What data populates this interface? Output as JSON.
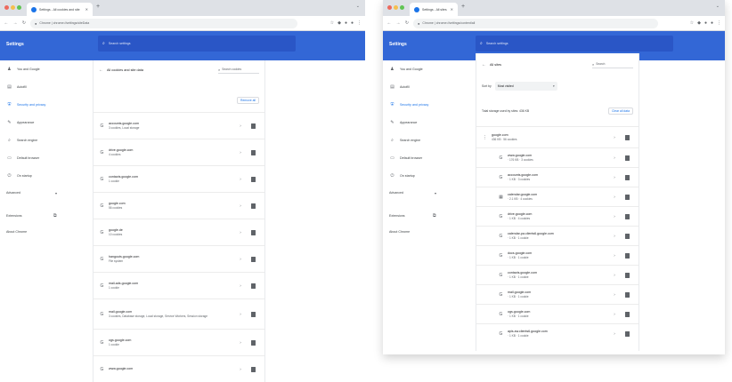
{
  "colors": {
    "header_blue": "#3367d6",
    "accent": "#1a73e8",
    "tabstrip": "#dee1e6"
  },
  "left": {
    "tab_title": "Settings - All cookies and site",
    "url": "Chrome | chrome://settings/siteData",
    "settings_title": "Settings",
    "search_placeholder": "Search settings",
    "sidebar": [
      {
        "icon": "person-icon",
        "label": "You and Google",
        "active": false
      },
      {
        "icon": "autofill-icon",
        "label": "Autofill",
        "active": false
      },
      {
        "icon": "shield-icon",
        "label": "Security and privacy",
        "active": true
      },
      {
        "icon": "appearance-icon",
        "label": "Appearance",
        "active": false
      },
      {
        "icon": "search-engine-icon",
        "label": "Search engine",
        "active": false
      },
      {
        "icon": "browser-icon",
        "label": "Default browser",
        "active": false
      },
      {
        "icon": "power-icon",
        "label": "On startup",
        "active": false
      }
    ],
    "advanced": "Advanced",
    "extensions": "Extensions",
    "about": "About Chrome",
    "header_label": "All cookies and site data",
    "search_cookies": "Search cookies",
    "remove_all": "Remove all",
    "sites": [
      {
        "name": "accounts.google.com",
        "sub": "3 cookies, Local storage"
      },
      {
        "name": "drive.google.com",
        "sub": "4 cookies"
      },
      {
        "name": "contacts.google.com",
        "sub": "1 cookie"
      },
      {
        "name": "google.com",
        "sub": "56 cookies"
      },
      {
        "name": "google.de",
        "sub": "10 cookies"
      },
      {
        "name": "hangouts.google.com",
        "sub": "File system"
      },
      {
        "name": "mail-ads.google.com",
        "sub": "1 cookie"
      },
      {
        "name": "mail.google.com",
        "sub": "3 cookies, Database storage, Local storage, Service Workers, Session storage"
      },
      {
        "name": "ogs.google.com",
        "sub": "1 cookie"
      },
      {
        "name": "www.google.com",
        "sub": ""
      }
    ]
  },
  "right": {
    "tab_title": "Settings - All sites",
    "url": "Chrome | chrome://settings/content/all",
    "settings_title": "Settings",
    "search_placeholder": "Search settings",
    "sidebar": [
      {
        "icon": "person-icon",
        "label": "You and Google",
        "active": false
      },
      {
        "icon": "autofill-icon",
        "label": "Autofill",
        "active": false
      },
      {
        "icon": "shield-icon",
        "label": "Security and privacy",
        "active": true
      },
      {
        "icon": "appearance-icon",
        "label": "Appearance",
        "active": false
      },
      {
        "icon": "search-engine-icon",
        "label": "Search engine",
        "active": false
      },
      {
        "icon": "browser-icon",
        "label": "Default browser",
        "active": false
      },
      {
        "icon": "power-icon",
        "label": "On startup",
        "active": false
      }
    ],
    "advanced": "Advanced",
    "extensions": "Extensions",
    "about": "About Chrome",
    "header_label": "All sites",
    "search_label": "Search",
    "sort_label": "Sort by",
    "sort_value": "Most visited",
    "section_title": "Total storage used by sites: 436 KB",
    "clear_all": "Clear all data",
    "group": {
      "name": "google.com",
      "sub": "436 KB · 56 cookies"
    },
    "sites": [
      {
        "name": "www.google.com",
        "sub": "· 176 KB · 3 cookies"
      },
      {
        "name": "accounts.google.com",
        "sub": "· 1 KB · 3 cookies"
      },
      {
        "name": "calendar.google.com",
        "sub": "· 2.1 KB · 4 cookies"
      },
      {
        "name": "drive.google.com",
        "sub": "· 1 KB · 4 cookies"
      },
      {
        "name": "calendar-pa.clients6.google.com",
        "sub": "· 1 KB · 1 cookie"
      },
      {
        "name": "docs.google.com",
        "sub": "· 1 KB · 1 cookie"
      },
      {
        "name": "contacts.google.com",
        "sub": "· 1 KB · 1 cookie"
      },
      {
        "name": "mail.google.com",
        "sub": "· 1 KB · 1 cookie"
      },
      {
        "name": "ogs.google.com",
        "sub": "· 1 KB · 1 cookie"
      },
      {
        "name": "apis-sw.clients6.google.com",
        "sub": "· 1 KB · 1 cookie"
      }
    ]
  }
}
